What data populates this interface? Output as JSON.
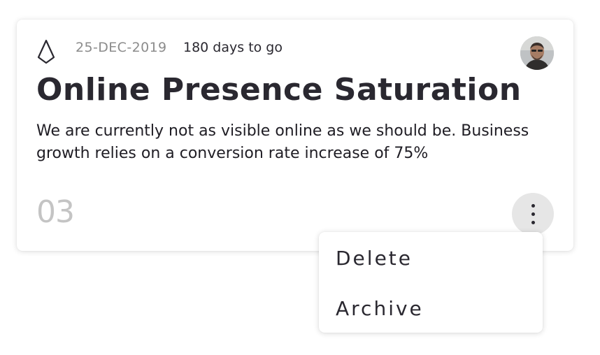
{
  "card": {
    "date": "25-DEC-2019",
    "countdown": "180 days to go",
    "title": "Online Presence Saturation",
    "description": "We are currently not as visible online as we should be. Business growth relies on a conversion rate increase of 75%",
    "number": "03",
    "icons": {
      "badge": "diamond-icon",
      "more": "more-vertical-icon"
    }
  },
  "menu": {
    "items": [
      {
        "label": "Delete"
      },
      {
        "label": "Archive"
      }
    ]
  }
}
